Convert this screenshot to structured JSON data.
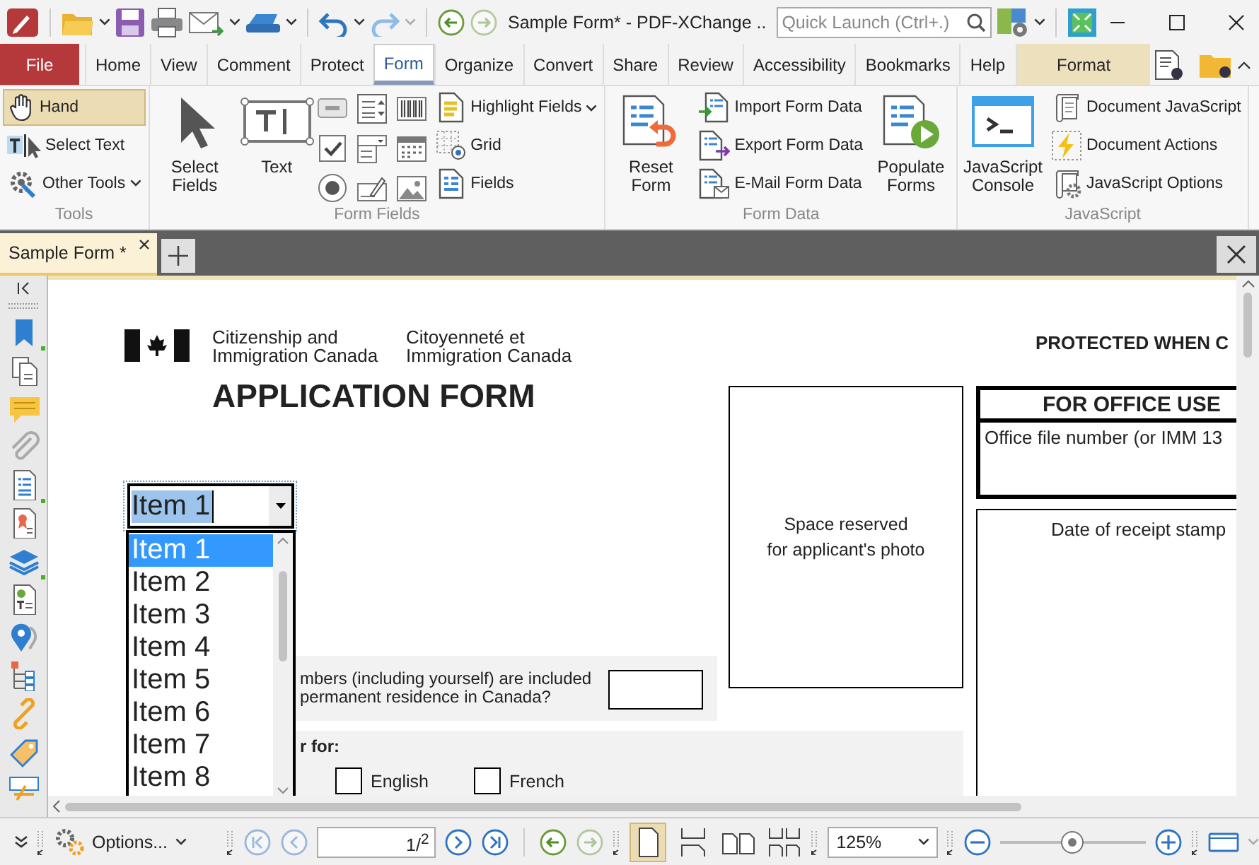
{
  "title_bar": {
    "title": "Sample Form* - PDF-XChange ..",
    "search": {
      "placeholder": "Quick Launch (Ctrl+.)"
    }
  },
  "menu_tabs": [
    {
      "label": "File",
      "kind": "file",
      "selected": false
    },
    {
      "label": "Home",
      "kind": "tab",
      "selected": false
    },
    {
      "label": "View",
      "kind": "tab",
      "selected": false
    },
    {
      "label": "Comment",
      "kind": "tab",
      "selected": false
    },
    {
      "label": "Protect",
      "kind": "tab",
      "selected": false
    },
    {
      "label": "Form",
      "kind": "tab",
      "selected": true
    },
    {
      "label": "Organize",
      "kind": "tab",
      "selected": false
    },
    {
      "label": "Convert",
      "kind": "tab",
      "selected": false
    },
    {
      "label": "Share",
      "kind": "tab",
      "selected": false
    },
    {
      "label": "Review",
      "kind": "tab",
      "selected": false
    },
    {
      "label": "Accessibility",
      "kind": "tab",
      "selected": false
    },
    {
      "label": "Bookmarks",
      "kind": "tab",
      "selected": false
    },
    {
      "label": "Help",
      "kind": "tab",
      "selected": false
    },
    {
      "label": "Format",
      "kind": "context",
      "selected": false
    }
  ],
  "ribbon": {
    "groups": [
      {
        "title": "Tools",
        "items": [
          {
            "kind": "column",
            "items": [
              {
                "label": "Hand",
                "selected": true
              },
              {
                "label": "Select Text",
                "selected": false
              },
              {
                "label": "Other Tools",
                "selected": false,
                "menu": true
              }
            ]
          }
        ]
      },
      {
        "title": "Form Fields",
        "items": [
          {
            "kind": "large",
            "label": "Select Fields"
          },
          {
            "kind": "large",
            "label": "Text"
          },
          {
            "kind": "icon_grid"
          },
          {
            "kind": "column",
            "items": [
              {
                "label": "Highlight Fields",
                "menu": true
              },
              {
                "label": "Grid"
              },
              {
                "label": "Fields"
              }
            ]
          }
        ]
      },
      {
        "title": "Form Data",
        "items": [
          {
            "kind": "large",
            "label": "Reset Form"
          },
          {
            "kind": "column",
            "items": [
              {
                "label": "Import Form Data"
              },
              {
                "label": "Export Form Data"
              },
              {
                "label": "E-Mail Form Data"
              }
            ]
          },
          {
            "kind": "large",
            "label": "Populate Forms"
          }
        ]
      },
      {
        "title": "JavaScript",
        "items": [
          {
            "kind": "large",
            "label": "JavaScript Console"
          },
          {
            "kind": "column",
            "items": [
              {
                "label": "Document JavaScript"
              },
              {
                "label": "Document Actions"
              },
              {
                "label": "JavaScript Options"
              }
            ]
          }
        ]
      }
    ]
  },
  "document_tabs": [
    {
      "label": "Sample Form *",
      "selected": true
    }
  ],
  "document": {
    "agency_en": "Citizenship and\nImmigration Canada",
    "agency_fr": "Citoyenneté et\nImmigration Canada",
    "title": "APPLICATION FORM",
    "protected": "PROTECTED WHEN C",
    "photo_box": "Space reserved\nfor applicant's photo",
    "office_box": {
      "heading": "FOR OFFICE USE",
      "file_number": "Office file number (or IMM 13"
    },
    "stamp_box": "Date of receipt stamp",
    "question": "mbers (including yourself) are included\npermanent residence in Canada?",
    "apply_for": "r for:",
    "checkboxes": [
      {
        "label": "English",
        "checked": false
      },
      {
        "label": "French",
        "checked": false
      }
    ],
    "combo": {
      "value": "Item 1",
      "expanded": true,
      "items": [
        {
          "label": "Item 1",
          "selected": true
        },
        {
          "label": "Item 2",
          "selected": false
        },
        {
          "label": "Item 3",
          "selected": false
        },
        {
          "label": "Item 4",
          "selected": false
        },
        {
          "label": "Item 5",
          "selected": false
        },
        {
          "label": "Item 6",
          "selected": false
        },
        {
          "label": "Item 7",
          "selected": false
        },
        {
          "label": "Item 8",
          "selected": false
        }
      ]
    }
  },
  "status_bar": {
    "options": "Options...",
    "page": "1/$^{2}$",
    "zoom": "125%",
    "zoom_slider": {
      "level": 0.5
    }
  }
}
